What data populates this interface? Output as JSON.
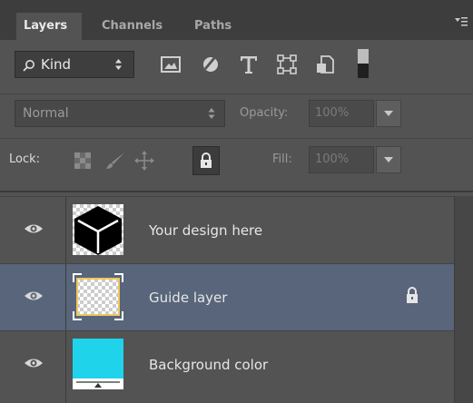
{
  "tabs": [
    {
      "label": "Layers",
      "active": true
    },
    {
      "label": "Channels",
      "active": false
    },
    {
      "label": "Paths",
      "active": false
    }
  ],
  "filter": {
    "kind_label": "Kind",
    "icons": [
      "image-filter-icon",
      "adjustment-filter-icon",
      "type-filter-icon",
      "shape-filter-icon",
      "smart-object-filter-icon",
      "filter-toggle-icon"
    ]
  },
  "blend": {
    "mode": "Normal",
    "opacity_label": "Opacity:",
    "opacity_value": "100%"
  },
  "lock": {
    "label": "Lock:",
    "fill_label": "Fill:",
    "fill_value": "100%",
    "icons": [
      "lock-transparent-pixels-icon",
      "lock-image-pixels-icon",
      "lock-position-icon",
      "lock-all-icon"
    ]
  },
  "layers": [
    {
      "name": "Your design here",
      "thumb": "cube",
      "selected": false,
      "locked": false
    },
    {
      "name": "Guide layer",
      "thumb": "guide",
      "selected": true,
      "locked": true
    },
    {
      "name": "Background color",
      "thumb": "background",
      "selected": false,
      "locked": false
    }
  ],
  "colors": {
    "panel": "#535353",
    "tabbar": "#3d3d3d",
    "selected_row": "#58657a",
    "background_fill": "#1fd3ea",
    "guide_border": "#f0c75e"
  }
}
